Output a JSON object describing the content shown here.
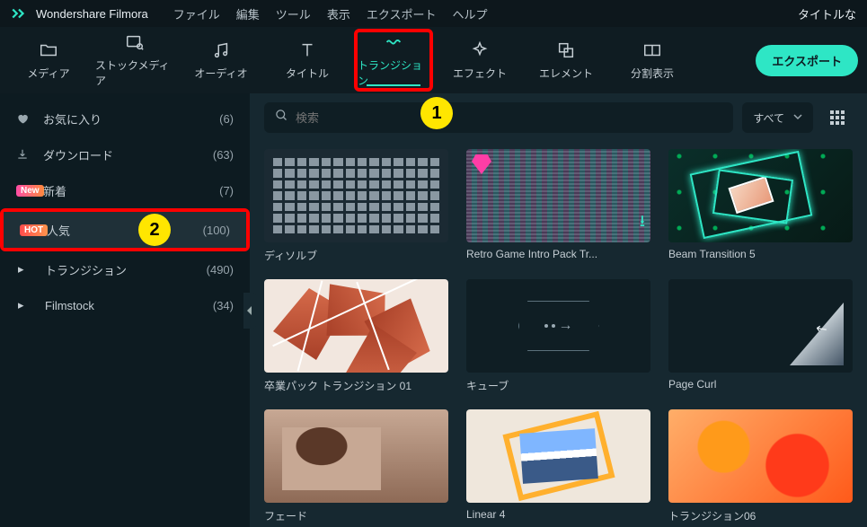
{
  "titlebar": {
    "app_name": "Wondershare Filmora",
    "menus": [
      "ファイル",
      "編集",
      "ツール",
      "表示",
      "エクスポート",
      "ヘルプ"
    ],
    "right": "タイトルな"
  },
  "toolbar": {
    "items": [
      {
        "label": "メディア"
      },
      {
        "label": "ストックメディア"
      },
      {
        "label": "オーディオ"
      },
      {
        "label": "タイトル"
      },
      {
        "label": "トランジション"
      },
      {
        "label": "エフェクト"
      },
      {
        "label": "エレメント"
      },
      {
        "label": "分割表示"
      }
    ],
    "export_label": "エクスポート"
  },
  "annotations": {
    "step1": "1",
    "step2": "2"
  },
  "sidebar": {
    "items": [
      {
        "icon": "heart",
        "label": "お気に入り",
        "count": "(6)"
      },
      {
        "icon": "download",
        "label": "ダウンロード",
        "count": "(63)"
      },
      {
        "badge": "New",
        "label": "新着",
        "count": "(7)"
      },
      {
        "badge": "HOT",
        "label": "人気",
        "count": "(100)"
      },
      {
        "icon": "caret",
        "label": "トランジション",
        "count": "(490)"
      },
      {
        "icon": "caret",
        "label": "Filmstock",
        "count": "(34)"
      }
    ]
  },
  "search": {
    "placeholder": "検索",
    "filter_label": "すべて"
  },
  "grid": {
    "cards": [
      {
        "label": "ディソルブ"
      },
      {
        "label": "Retro Game Intro Pack Tr..."
      },
      {
        "label": "Beam Transition 5"
      },
      {
        "label": "卒業パック トランジション 01"
      },
      {
        "label": "キューブ"
      },
      {
        "label": "Page Curl"
      },
      {
        "label": "フェード"
      },
      {
        "label": "Linear 4"
      },
      {
        "label": "トランジション06"
      }
    ]
  }
}
